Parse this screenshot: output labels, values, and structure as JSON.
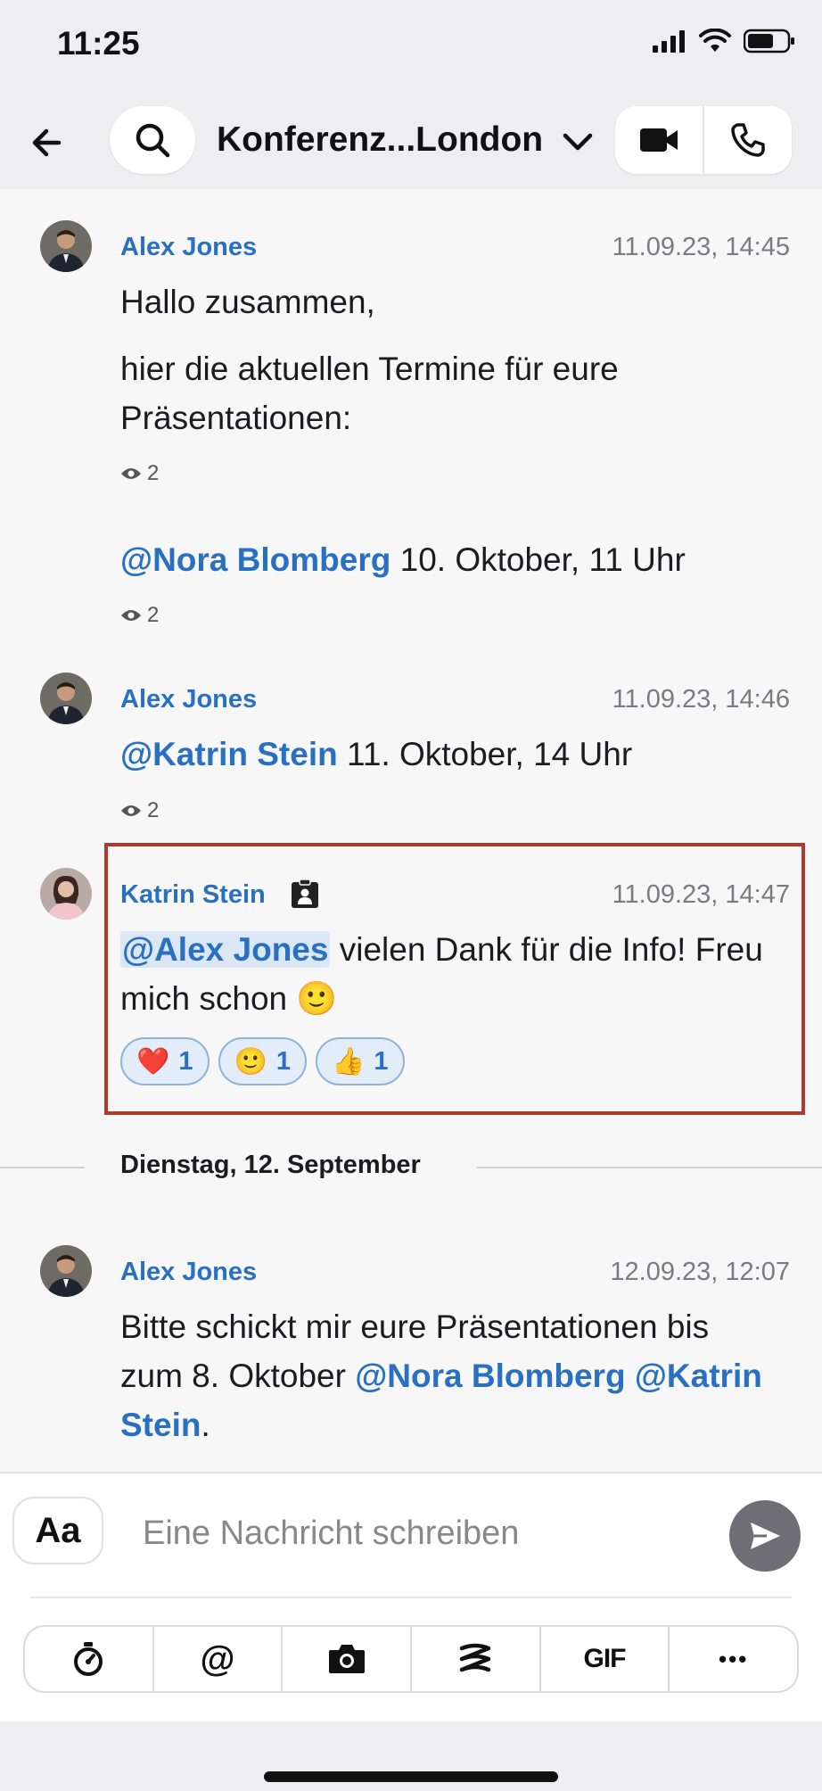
{
  "status_bar": {
    "time": "11:25"
  },
  "header": {
    "title": "Konferenz...London"
  },
  "messages": [
    {
      "author": "Alex Jones",
      "time": "11.09.23, 14:45",
      "line1": "Hallo zusammen,",
      "line2": "hier die aktuellen Termine für eure",
      "line3": "Präsentationen:",
      "seen": "2"
    },
    {
      "mention": "@Nora Blomberg",
      "text": " 10. Oktober, 11 Uhr",
      "seen": "2"
    },
    {
      "author": "Alex Jones",
      "time": "11.09.23, 14:46",
      "mention": "@Katrin Stein",
      "text": " 11. Oktober, 14 Uhr",
      "seen": "2"
    },
    {
      "author": "Katrin Stein",
      "time": "11.09.23, 14:47",
      "mention": "@Alex Jones",
      "text1": " vielen Dank für die Info! Freu",
      "text2": "mich schon 🙂",
      "reactions": [
        {
          "emoji": "❤️",
          "count": "1"
        },
        {
          "emoji": "🙂",
          "count": "1"
        },
        {
          "emoji": "👍",
          "count": "1"
        }
      ]
    },
    {
      "author": "Alex Jones",
      "time": "12.09.23, 12:07",
      "text1": "Bitte schickt mir eure Präsentationen bis",
      "text2": "zum 8. Oktober ",
      "mention1": "@Nora Blomberg",
      "mention2": "@Katrin",
      "mention2b": "Stein",
      "end": "."
    }
  ],
  "date_separator": "Dienstag, 12. September",
  "composer": {
    "format_label": "Aa",
    "placeholder": "Eine Nachricht schreiben",
    "toolbar": {
      "mention": "@",
      "gif": "GIF",
      "more": "•••"
    }
  },
  "colors": {
    "accent": "#2a70c2",
    "highlight_border": "#b13a2e"
  }
}
